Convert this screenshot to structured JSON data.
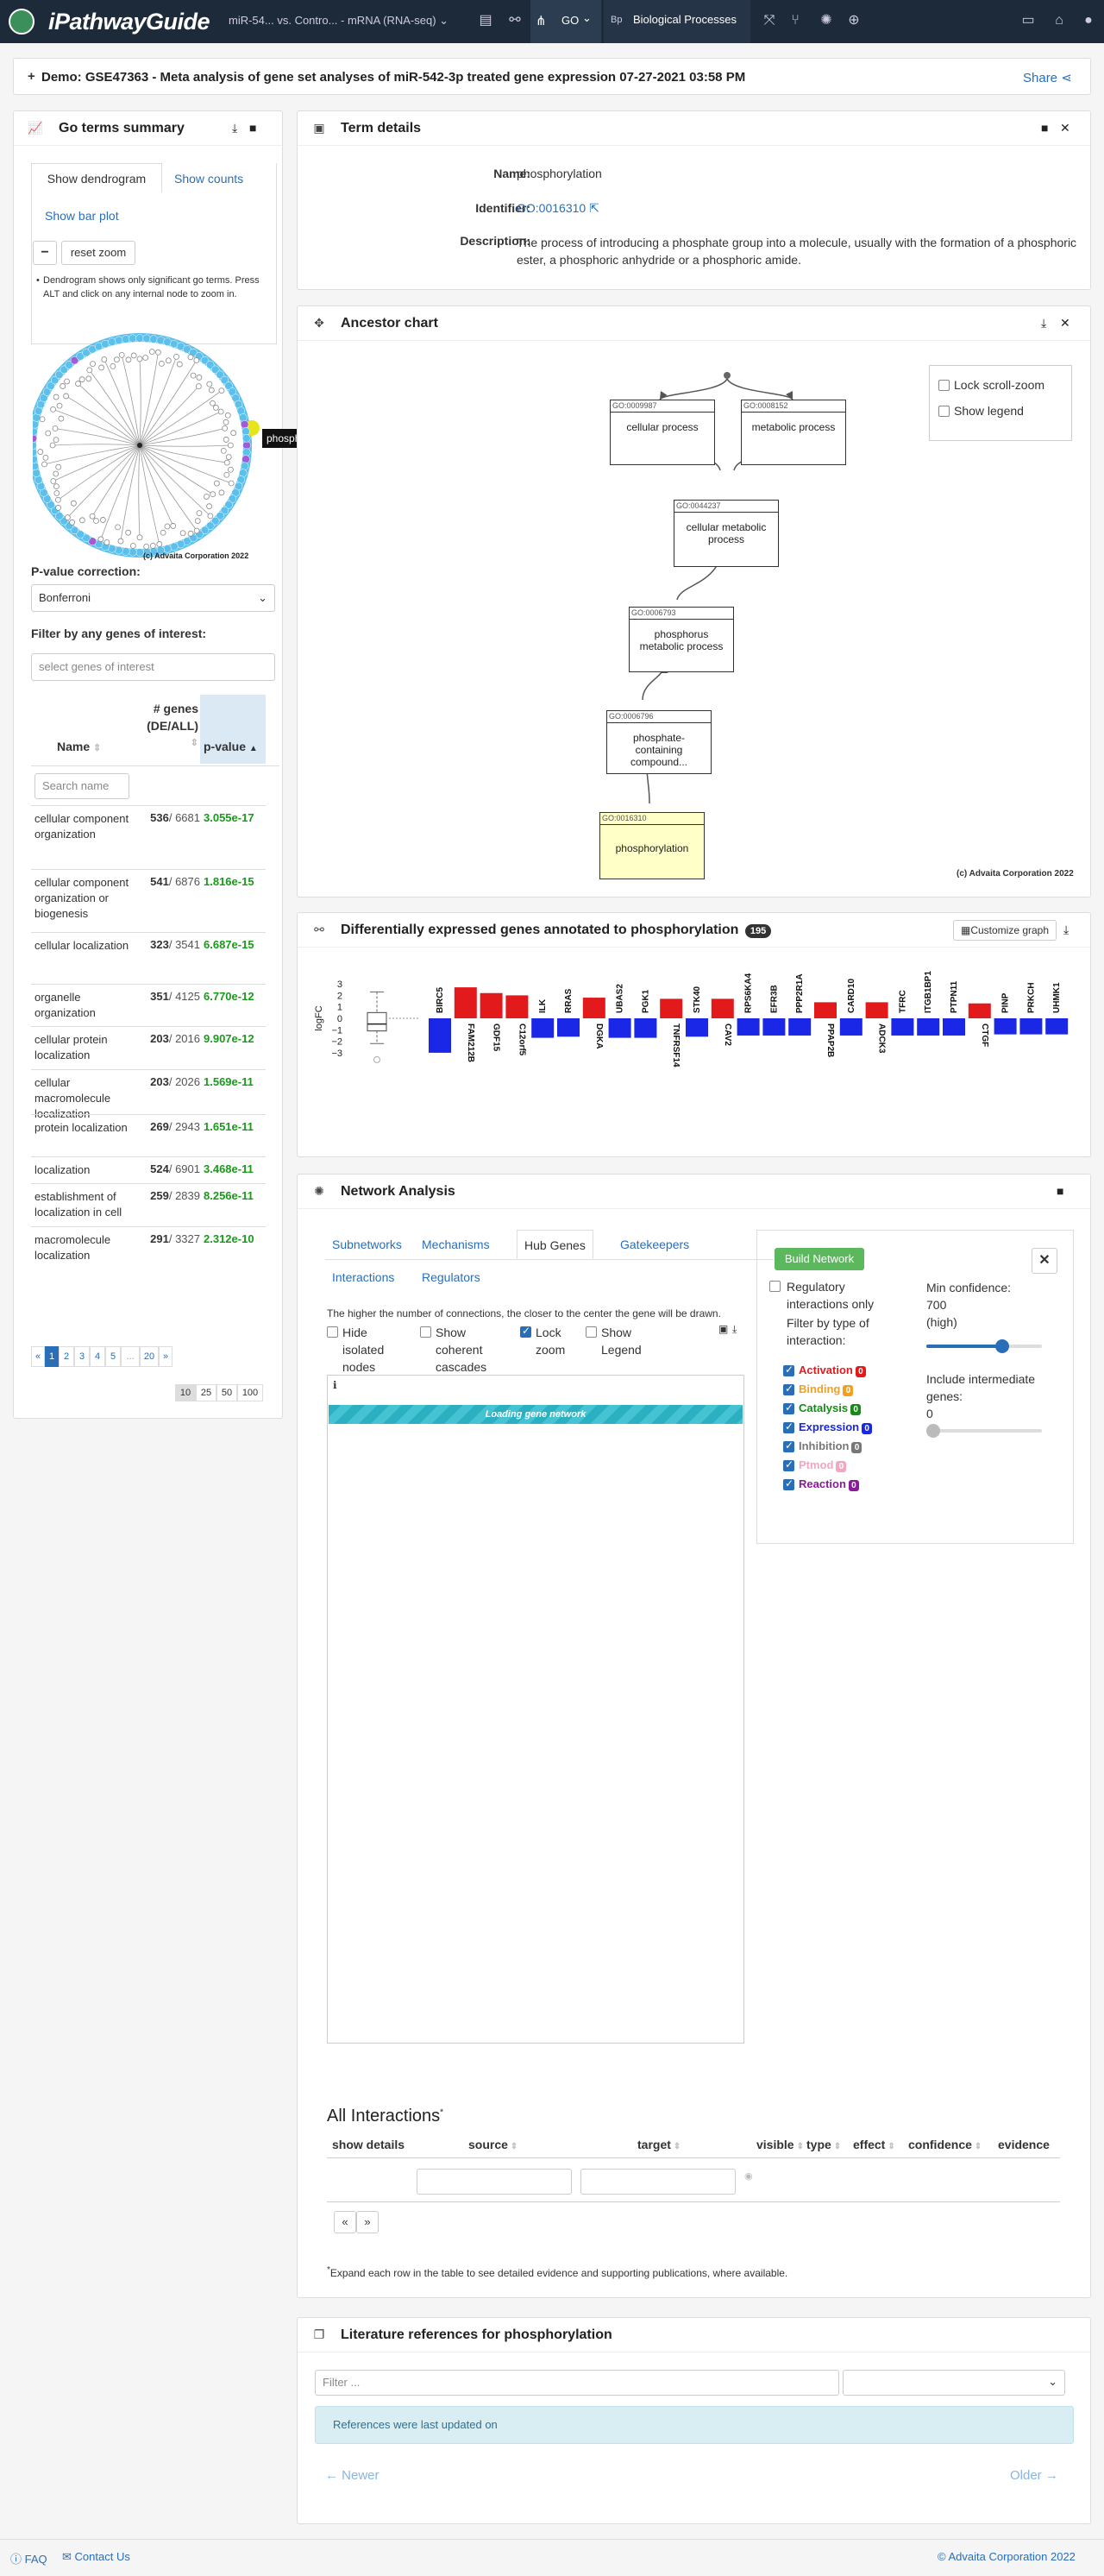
{
  "nav": {
    "brand": "iPathwayGuide",
    "contrast": "miR-54... vs. Contro... - mRNA (RNA-seq)",
    "go": "GO",
    "bp_abbr": "Bp",
    "bp": "Biological Processes"
  },
  "colors": {
    "navbar": "#1d2a3a",
    "link": "#2a6eb8",
    "up": "#e31a1c",
    "down": "#1b27e6",
    "pval": "#1a9a1a"
  },
  "demo": {
    "title": "Demo: GSE47363 - Meta analysis of gene set analyses of miR-542-3p treated gene expression 07-27-2021 03:58 PM",
    "share": "Share"
  },
  "summary": {
    "title": "Go terms summary",
    "tabs": [
      "Show dendrogram",
      "Show counts",
      "Show bar plot"
    ],
    "minus": "−",
    "reset": "reset zoom",
    "note": "Dendrogram shows only significant go terms. Press ALT and click on any internal node to zoom in.",
    "tooltip": "phosphorylation",
    "copyright": "(c) Advaita Corporation 2022",
    "pcorr_label": "P-value correction:",
    "pcorr_value": "Bonferroni",
    "filter_label": "Filter by any genes of interest:",
    "filter_placeholder": "select genes of interest",
    "col_name": "Name",
    "col_genes_1": "# genes",
    "col_genes_2": "(DE/ALL)",
    "col_pvalue": "p-value",
    "search_placeholder": "Search name",
    "rows": [
      {
        "name": "cellular component organization",
        "de": "536",
        "all": "/ 6681",
        "p": "3.055e-17"
      },
      {
        "name": "cellular component organization or biogenesis",
        "de": "541",
        "all": "/ 6876",
        "p": "1.816e-15"
      },
      {
        "name": "cellular localization",
        "de": "323",
        "all": "/ 3541",
        "p": "6.687e-15"
      },
      {
        "name": "organelle organization",
        "de": "351",
        "all": "/ 4125",
        "p": "6.770e-12"
      },
      {
        "name": "cellular protein localization",
        "de": "203",
        "all": "/ 2016",
        "p": "9.907e-12"
      },
      {
        "name": "cellular macromolecule localization",
        "de": "203",
        "all": "/ 2026",
        "p": "1.569e-11"
      },
      {
        "name": "protein localization",
        "de": "269",
        "all": "/ 2943",
        "p": "1.651e-11"
      },
      {
        "name": "localization",
        "de": "524",
        "all": "/ 6901",
        "p": "3.468e-11"
      },
      {
        "name": "establishment of localization in cell",
        "de": "259",
        "all": "/ 2839",
        "p": "8.256e-11"
      },
      {
        "name": "macromolecule localization",
        "de": "291",
        "all": "/ 3327",
        "p": "2.312e-10"
      }
    ],
    "pages": [
      "«",
      "1",
      "2",
      "3",
      "4",
      "5",
      "...",
      "20",
      "»"
    ],
    "page_sizes": [
      "10",
      "25",
      "50",
      "100"
    ]
  },
  "term": {
    "title": "Term details",
    "name_label": "Name:",
    "name": "phosphorylation",
    "id_label": "Identifier:",
    "id": "GO:0016310",
    "desc_label": "Description:",
    "desc": "The process of introducing a phosphate group into a molecule, usually with the formation of a phosphoric ester, a phosphoric anhydride or a phosphoric amide."
  },
  "ancestor": {
    "title": "Ancestor chart",
    "lock": "Lock scroll-zoom",
    "legend": "Show legend",
    "copyright": "(c) Advaita Corporation 2022",
    "nodes": [
      {
        "id": "GO:0009987",
        "label": "cellular process"
      },
      {
        "id": "GO:0008152",
        "label": "metabolic process"
      },
      {
        "id": "GO:0044237",
        "label": "cellular metabolic process"
      },
      {
        "id": "GO:0006793",
        "label": "phosphorus metabolic process"
      },
      {
        "id": "GO:0006796",
        "label": "phosphate-containing compound..."
      },
      {
        "id": "GO:0016310",
        "label": "phosphorylation"
      }
    ]
  },
  "deg": {
    "title": "Differentially expressed genes annotated to phosphorylation",
    "count": "195",
    "customize": "Customize graph"
  },
  "chart_data": {
    "type": "bar",
    "ylabel": "logFC",
    "ylim": [
      -3,
      3
    ],
    "yticks": [
      "3",
      "2",
      "1",
      "0",
      "−1",
      "−2",
      "−3"
    ],
    "categories": [
      "BIRC5",
      "FAM212B",
      "GDF15",
      "C12orf5",
      "ILK",
      "RRAS",
      "DGKA",
      "UBAS2",
      "PGK1",
      "TNFRSF14",
      "STK40",
      "CAV2",
      "RPS6KA4",
      "EFR3B",
      "PPP2R1A",
      "PPAP2B",
      "CARD10",
      "ADCK3",
      "TFRC",
      "ITGB1BP1",
      "PTPN11",
      "CTGF",
      "PINP",
      "PRKCH",
      "UHMK1"
    ],
    "values": [
      -3.0,
      2.7,
      2.2,
      2.0,
      -1.7,
      -1.6,
      1.8,
      -1.7,
      -1.7,
      1.7,
      -1.6,
      1.7,
      -1.5,
      -1.5,
      -1.5,
      1.4,
      -1.5,
      1.4,
      -1.5,
      -1.5,
      -1.5,
      1.3,
      -1.4,
      -1.4,
      -1.4
    ],
    "box": {
      "min": -2.2,
      "q1": -1.1,
      "median": -0.5,
      "q3": 0.5,
      "max": 2.3,
      "outlier": -3.0
    }
  },
  "network": {
    "title": "Network Analysis",
    "tabs": [
      "Subnetworks",
      "Mechanisms",
      "Hub Genes",
      "Gatekeepers",
      "Interactions",
      "Regulators"
    ],
    "hint": "The higher the number of connections, the closer to the center the gene will be drawn.",
    "opts": [
      "Hide isolated nodes",
      "Show coherent cascades",
      "Lock zoom",
      "Show Legend"
    ],
    "loading": "Loading gene network",
    "build": "Build Network",
    "regulatory": "Regulatory interactions only",
    "filter_type": "Filter by type of interaction:",
    "types": [
      {
        "label": "Activation",
        "count": "0",
        "color": "#e31a1c"
      },
      {
        "label": "Binding",
        "count": "0",
        "color": "#f0a020"
      },
      {
        "label": "Catalysis",
        "count": "0",
        "color": "#168a16"
      },
      {
        "label": "Expression",
        "count": "0",
        "color": "#1b27e6"
      },
      {
        "label": "Inhibition",
        "count": "0",
        "color": "#777777"
      },
      {
        "label": "Ptmod",
        "count": "0",
        "color": "#f2a6c0"
      },
      {
        "label": "Reaction",
        "count": "0",
        "color": "#8a1a9a"
      }
    ],
    "min_conf_label": "Min confidence:",
    "min_conf_value": "700",
    "min_conf_level": "(high)",
    "intermediate_label": "Include intermediate genes:",
    "intermediate_value": "0",
    "all_title": "All Interactions",
    "all_cols": [
      "show details",
      "source",
      "target",
      "visible",
      "type",
      "effect",
      "confidence",
      "evidence"
    ],
    "footnote": "Expand each row in the table to see detailed evidence and supporting publications, where available.",
    "prev": "«",
    "next": "»"
  },
  "lit": {
    "title": "Literature references for phosphorylation",
    "filter_placeholder": "Filter ...",
    "notice": "References were last updated on",
    "newer": "← Newer",
    "older": "Older →"
  },
  "footer": {
    "faq": "FAQ",
    "contact": "Contact Us",
    "copyright": "© Advaita Corporation 2022"
  }
}
